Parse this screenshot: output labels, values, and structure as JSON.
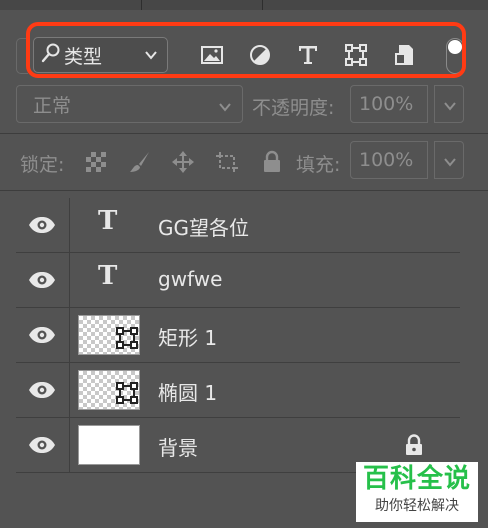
{
  "filter": {
    "kind_label": "类型",
    "icons": [
      "image-filter-icon",
      "adjustment-filter-icon",
      "text-filter-icon",
      "shape-filter-icon",
      "smart-object-filter-icon"
    ],
    "toggle": "filter-toggle"
  },
  "blend": {
    "mode": "正常",
    "opacity_label": "不透明度:",
    "opacity_value": "100%"
  },
  "lock": {
    "label": "锁定:",
    "fill_label": "填充:",
    "fill_value": "100%"
  },
  "layers": [
    {
      "name": "GG望各位",
      "type": "text"
    },
    {
      "name": "gwfwe",
      "type": "text"
    },
    {
      "name": "矩形 1",
      "type": "shape"
    },
    {
      "name": "椭圆 1",
      "type": "shape"
    },
    {
      "name": "背景",
      "type": "background",
      "locked": true
    }
  ],
  "watermark": {
    "title": "百科全说",
    "subtitle": "助你轻松解决"
  },
  "colors": {
    "highlight": "#ff3b14",
    "panel": "#535353",
    "watermark_green": "#26c04a"
  }
}
